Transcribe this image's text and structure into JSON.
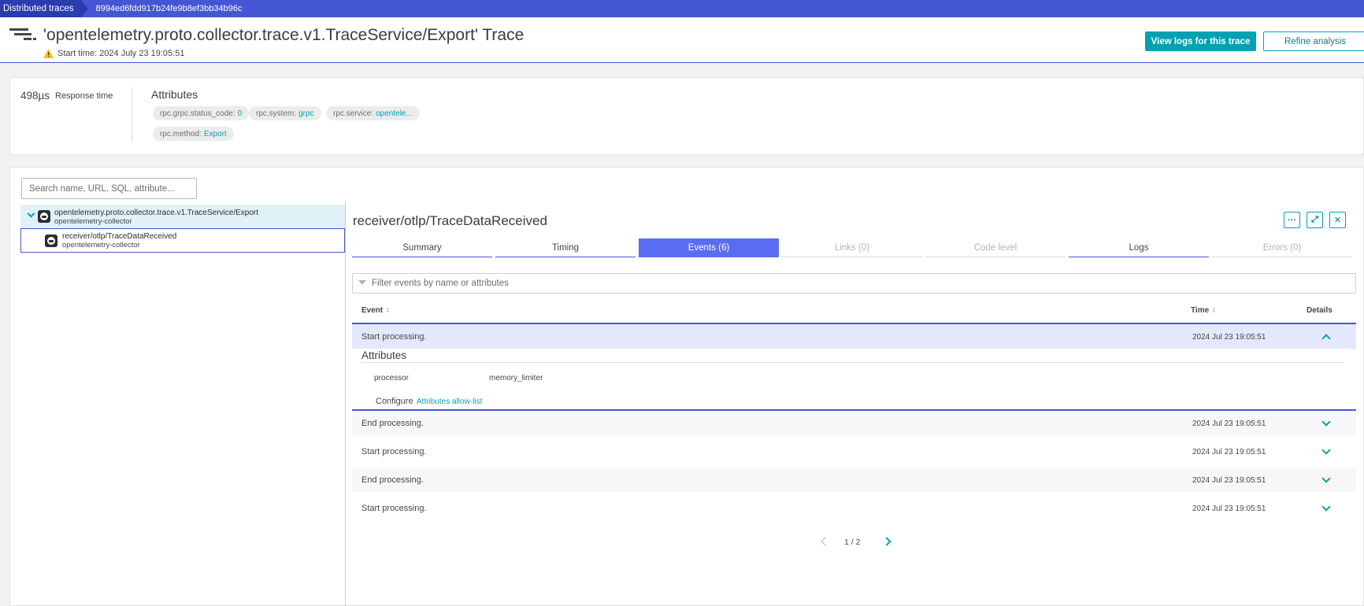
{
  "breadcrumb": {
    "root": "Distributed traces",
    "current": "8994ed6fdd917b24fe9b8ef3bb34b96c"
  },
  "header": {
    "title": "'opentelemetry.proto.collector.trace.v1.TraceService/Export' Trace",
    "start_time": "Start time: 2024 July 23 19:05:51",
    "view_logs": "View logs for this trace",
    "refine": "Refine analysis",
    "more": "···"
  },
  "summary": {
    "response_value": "498µs",
    "response_label": "Response time",
    "attributes_title": "Attributes",
    "chips": [
      {
        "key": "rpc.grpc.status_code:",
        "value": "0"
      },
      {
        "key": "rpc.system:",
        "value": "grpc"
      },
      {
        "key": "rpc.service:",
        "value": "opentele..."
      },
      {
        "key": "rpc.method:",
        "value": "Export"
      }
    ]
  },
  "tree": {
    "search_placeholder": "Search name, URL, SQL, attribute...",
    "nodes": [
      {
        "name": "opentelemetry.proto.collector.trace.v1.TraceService/Export",
        "service": "opentelemetry-collector"
      },
      {
        "name": "receiver/otlp/TraceDataReceived",
        "service": "opentelemetry-collector"
      }
    ]
  },
  "detail": {
    "title": "receiver/otlp/TraceDataReceived",
    "buttons": {
      "more": "···",
      "expand": "⤢",
      "close": "✕"
    },
    "tabs": [
      {
        "label": "Summary",
        "state": "normal"
      },
      {
        "label": "Timing",
        "state": "normal"
      },
      {
        "label": "Events (6)",
        "state": "active"
      },
      {
        "label": "Links (0)",
        "state": "disabled"
      },
      {
        "label": "Code level",
        "state": "disabled"
      },
      {
        "label": "Logs",
        "state": "normal"
      },
      {
        "label": "Errors (0)",
        "state": "disabled"
      }
    ],
    "filter_placeholder": "Filter events by name or attributes",
    "columns": {
      "event": "Event",
      "time": "Time",
      "details": "Details",
      "sort_icon": "⇕"
    },
    "events": [
      {
        "name": "Start processing.",
        "time": "2024 Jul 23 19:05:51"
      },
      {
        "name": "End processing.",
        "time": "2024 Jul 23 19:05:51"
      },
      {
        "name": "Start processing.",
        "time": "2024 Jul 23 19:05:51"
      },
      {
        "name": "End processing.",
        "time": "2024 Jul 23 19:05:51"
      },
      {
        "name": "Start processing.",
        "time": "2024 Jul 23 19:05:51"
      }
    ],
    "expanded": {
      "attributes_title": "Attributes",
      "key": "processor",
      "value": "memory_limiter",
      "configure_label": "Configure",
      "configure_link": "Attributes allow-list"
    },
    "pager": "1 / 2"
  },
  "colors": {
    "accent": "#00a1b2",
    "brand": "#4556d4",
    "active_tab": "#5a6cf2",
    "warning": "#f5c300"
  }
}
